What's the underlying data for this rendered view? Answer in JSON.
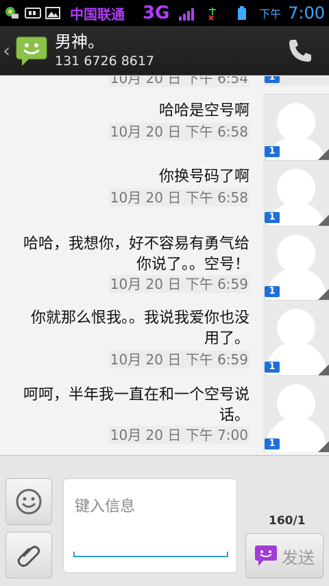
{
  "status_bar": {
    "carrier": "中国联通",
    "network": "3G",
    "ampm": "下午",
    "time": "7:00",
    "icons": [
      "app-notification-icon",
      "sim-icon",
      "image-icon",
      "signal-icon",
      "no-data-icon",
      "battery-icon"
    ]
  },
  "header": {
    "contact_name": "男神。",
    "contact_number": "131 6726 8617",
    "icons": [
      "back-chevron-icon",
      "sms-smiley-icon",
      "phone-icon"
    ]
  },
  "messages": [
    {
      "text": "",
      "time": "10月 20 日 下午 6:54",
      "badge": "1"
    },
    {
      "text": "哈哈是空号啊",
      "time": "10月 20 日 下午 6:58",
      "badge": "1"
    },
    {
      "text": "你换号码了啊",
      "time": "10月 20 日 下午 6:58",
      "badge": "1"
    },
    {
      "text": "哈哈，我想你，好不容易有勇气给你说了。。空号！",
      "time": "10月 20 日 下午 6:59",
      "badge": "1"
    },
    {
      "text": "你就那么恨我。。我说我爱你也没用了。",
      "time": "10月 20 日 下午 6:59",
      "badge": "1"
    },
    {
      "text": "呵呵，半年我一直在和一个空号说话。",
      "time": "10月 20 日 下午 7:00",
      "badge": "1"
    }
  ],
  "compose": {
    "placeholder": "键入信息",
    "counter": "160/1",
    "send_label": "发送",
    "icons": [
      "smiley-icon",
      "paperclip-icon",
      "send-sms-icon"
    ]
  },
  "colors": {
    "carrier_purple": "#b23cff",
    "time_blue": "#3fa9ff",
    "badge_blue": "#1e6fd9",
    "input_accent": "#2e9bd6"
  }
}
